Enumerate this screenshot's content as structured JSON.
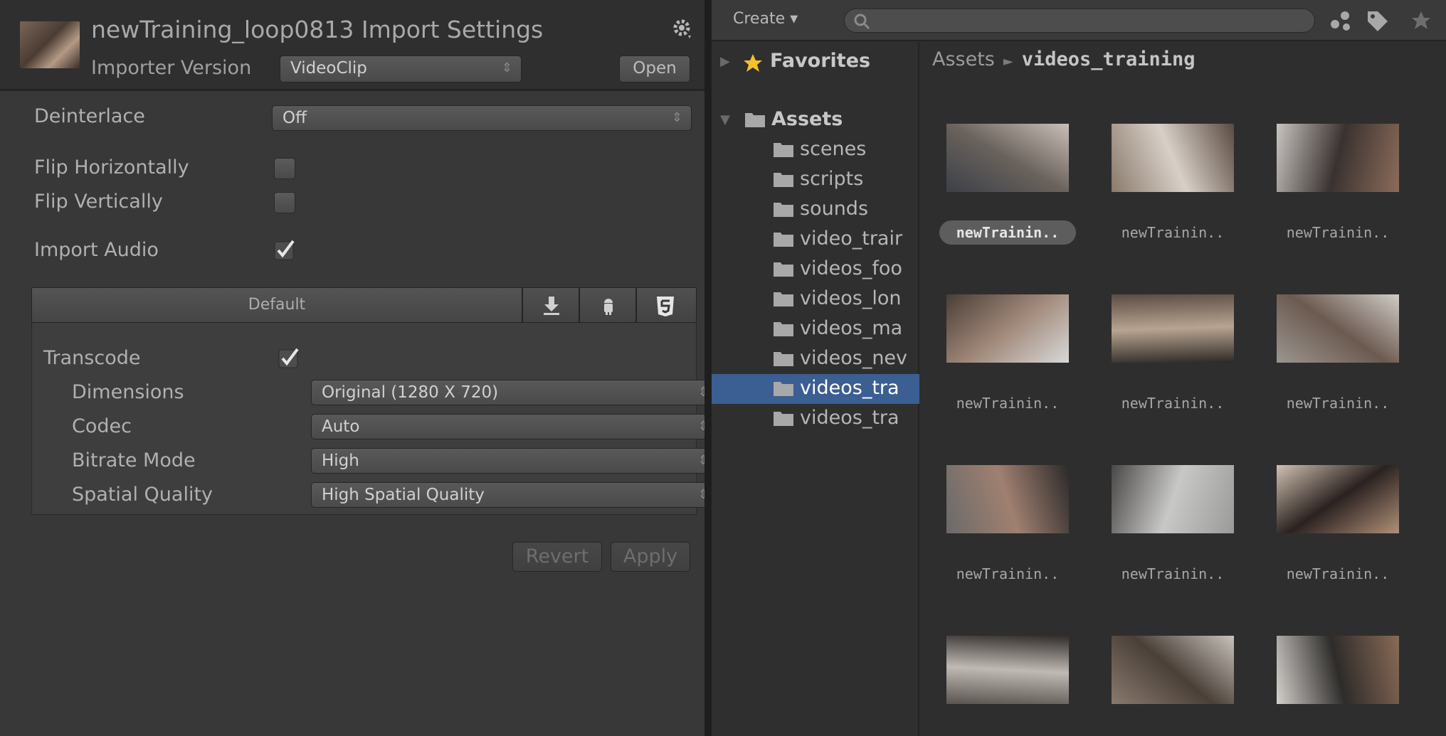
{
  "inspector": {
    "title": "newTraining_loop0813 Import Settings",
    "importer_version_label": "Importer Version",
    "importer_version_value": "VideoClip",
    "open_label": "Open",
    "deinterlace_label": "Deinterlace",
    "deinterlace_value": "Off",
    "flip_horizontally_label": "Flip Horizontally",
    "flip_horizontally_checked": false,
    "flip_vertically_label": "Flip Vertically",
    "flip_vertically_checked": false,
    "import_audio_label": "Import Audio",
    "import_audio_checked": true,
    "platform_default_label": "Default",
    "platform_tabs": [
      "download-icon",
      "android-icon",
      "html5-icon"
    ],
    "transcode_label": "Transcode",
    "transcode_checked": true,
    "dimensions_label": "Dimensions",
    "dimensions_value": "Original (1280 X 720)",
    "codec_label": "Codec",
    "codec_value": "Auto",
    "bitrate_label": "Bitrate Mode",
    "bitrate_value": "High",
    "spatial_label": "Spatial Quality",
    "spatial_value": "High Spatial Quality",
    "revert_label": "Revert",
    "apply_label": "Apply",
    "arrow_glyph": "⇕"
  },
  "project": {
    "create_label": "Create ▾",
    "toolbar_icons": [
      "filter-by-type-icon",
      "filter-by-label-icon",
      "favorite-star-icon"
    ],
    "favorites_label": "Favorites",
    "assets_label": "Assets",
    "folders": [
      "scenes",
      "scripts",
      "sounds",
      "video_trair",
      "videos_foo",
      "videos_lon",
      "videos_ma",
      "videos_nev",
      "videos_tra",
      "videos_tra"
    ],
    "selected_folder_index": 8,
    "breadcrumb_root": "Assets",
    "breadcrumb_sep": "►",
    "breadcrumb_current": "videos_training",
    "assets": [
      {
        "label": "newTrainin..",
        "selected": true
      },
      {
        "label": "newTrainin..",
        "selected": false
      },
      {
        "label": "newTrainin..",
        "selected": false
      },
      {
        "label": "newTrainin..",
        "selected": false
      },
      {
        "label": "newTrainin..",
        "selected": false
      },
      {
        "label": "newTrainin..",
        "selected": false
      },
      {
        "label": "newTrainin..",
        "selected": false
      },
      {
        "label": "newTrainin..",
        "selected": false
      },
      {
        "label": "newTrainin..",
        "selected": false
      },
      {
        "label": "",
        "selected": false
      },
      {
        "label": "",
        "selected": false
      },
      {
        "label": "",
        "selected": false
      }
    ]
  },
  "colors": {
    "selection": "#3b5e93",
    "panel": "#383838",
    "text": "#b4b4b4"
  }
}
